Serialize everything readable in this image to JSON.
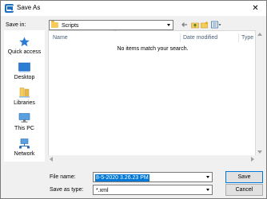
{
  "window": {
    "title": "Save As",
    "close_glyph": "✕"
  },
  "toolbar": {
    "save_in_label": "Save in:",
    "location": "Scripts"
  },
  "places": [
    {
      "label": "Quick access",
      "icon": "star-icon"
    },
    {
      "label": "Desktop",
      "icon": "desktop-icon"
    },
    {
      "label": "Libraries",
      "icon": "libraries-icon"
    },
    {
      "label": "This PC",
      "icon": "computer-icon"
    },
    {
      "label": "Network",
      "icon": "network-icon"
    }
  ],
  "file_list": {
    "columns": [
      "Name",
      "Date modified",
      "Type"
    ],
    "empty_message": "No items match your search."
  },
  "form": {
    "file_name_label": "File name:",
    "file_name_value": "8-5-2020 3.26.23 PM",
    "save_type_label": "Save as type:",
    "save_type_value": "*.xml"
  },
  "buttons": {
    "save": "Save",
    "cancel": "Cancel"
  },
  "colors": {
    "accent": "#0078d7",
    "folder": "#f5cc5a",
    "window_bg": "#f0f0f0"
  }
}
